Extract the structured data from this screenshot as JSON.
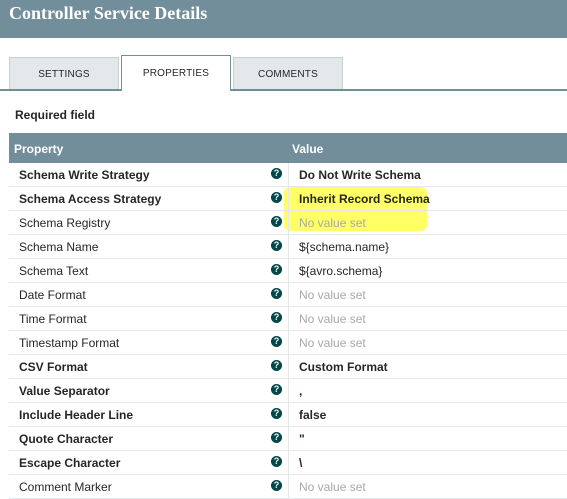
{
  "window": {
    "title": "Controller Service Details"
  },
  "tabs": [
    {
      "label": "SETTINGS",
      "active": false
    },
    {
      "label": "PROPERTIES",
      "active": true
    },
    {
      "label": "COMMENTS",
      "active": false
    }
  ],
  "required_label": "Required field",
  "table": {
    "headers": {
      "property": "Property",
      "value": "Value"
    },
    "rows": [
      {
        "property": "Schema Write Strategy",
        "value": "Do Not Write Schema",
        "required": true,
        "unset": false
      },
      {
        "property": "Schema Access Strategy",
        "value": "Inherit Record Schema",
        "required": true,
        "unset": false
      },
      {
        "property": "Schema Registry",
        "value": "No value set",
        "required": false,
        "unset": true
      },
      {
        "property": "Schema Name",
        "value": "${schema.name}",
        "required": false,
        "unset": false
      },
      {
        "property": "Schema Text",
        "value": "${avro.schema}",
        "required": false,
        "unset": false
      },
      {
        "property": "Date Format",
        "value": "No value set",
        "required": false,
        "unset": true
      },
      {
        "property": "Time Format",
        "value": "No value set",
        "required": false,
        "unset": true
      },
      {
        "property": "Timestamp Format",
        "value": "No value set",
        "required": false,
        "unset": true
      },
      {
        "property": "CSV Format",
        "value": "Custom Format",
        "required": true,
        "unset": false
      },
      {
        "property": "Value Separator",
        "value": ",",
        "required": true,
        "unset": false
      },
      {
        "property": "Include Header Line",
        "value": "false",
        "required": true,
        "unset": false
      },
      {
        "property": "Quote Character",
        "value": "\"",
        "required": true,
        "unset": false
      },
      {
        "property": "Escape Character",
        "value": "\\",
        "required": true,
        "unset": false
      },
      {
        "property": "Comment Marker",
        "value": "No value set",
        "required": false,
        "unset": true
      }
    ],
    "info_icon": "question-circle-icon",
    "info_glyph": "?"
  },
  "colors": {
    "header_bg": "#728e9b",
    "info_icon": "#004849",
    "highlight": "#ffff33",
    "unset_text": "#a8a8a8"
  }
}
